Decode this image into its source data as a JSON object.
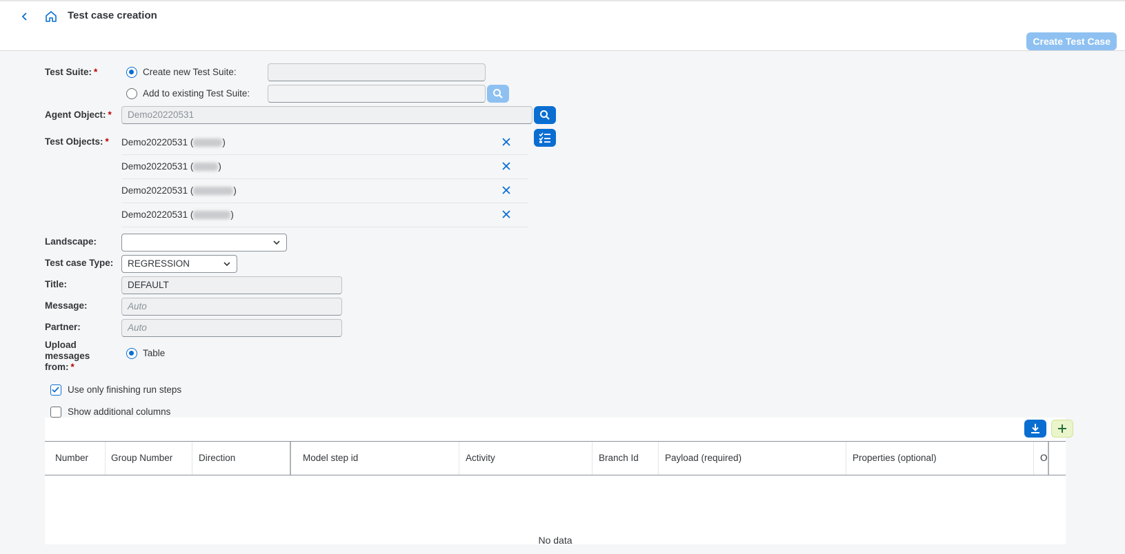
{
  "header": {
    "title": "Test case creation",
    "create_button": "Create Test Case"
  },
  "form": {
    "test_suite": {
      "label": "Test Suite:",
      "options": [
        {
          "label": "Create new Test Suite:",
          "selected": true,
          "value": ""
        },
        {
          "label": "Add to existing Test Suite:",
          "selected": false,
          "value": ""
        }
      ]
    },
    "agent_object": {
      "label": "Agent Object:",
      "value": "Demo20220531"
    },
    "test_objects": {
      "label": "Test Objects:",
      "items": [
        {
          "prefix": "Demo20220531 (",
          "suffix": ")"
        },
        {
          "prefix": "Demo20220531 (",
          "suffix": ")"
        },
        {
          "prefix": "Demo20220531 (",
          "suffix": ")"
        },
        {
          "prefix": "Demo20220531 (",
          "suffix": ")"
        }
      ]
    },
    "landscape": {
      "label": "Landscape:",
      "value": ""
    },
    "test_case_type": {
      "label": "Test case Type:",
      "value": "REGRESSION"
    },
    "title": {
      "label": "Title:",
      "value": "DEFAULT"
    },
    "message": {
      "label": "Message:",
      "placeholder": "Auto"
    },
    "partner": {
      "label": "Partner:",
      "placeholder": "Auto"
    },
    "upload_from": {
      "label_lines": [
        "Upload",
        "messages",
        "from:"
      ],
      "option": "Table",
      "selected": true
    },
    "use_finishing": {
      "label": "Use only finishing run steps",
      "checked": true
    },
    "show_additional": {
      "label": "Show additional columns",
      "checked": false
    }
  },
  "table": {
    "columns": [
      "Number",
      "Group Number",
      "Direction",
      "Model step id",
      "Activity",
      "Branch Id",
      "Payload (required)",
      "Properties (optional)",
      "Or"
    ],
    "empty_text": "No data"
  },
  "colors": {
    "accent": "#0a6ed1",
    "accent_disabled": "#8ec1f2",
    "required": "#bb0000",
    "add_button_bg": "#ebf5cb"
  }
}
